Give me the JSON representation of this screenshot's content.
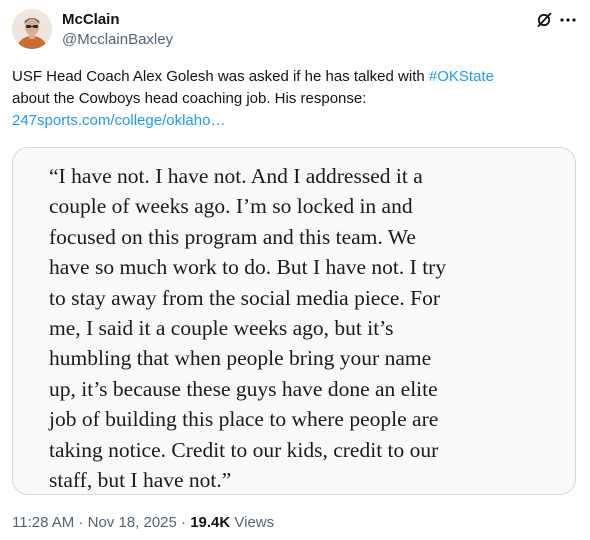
{
  "author": {
    "name": "McClain",
    "handle": "@McclainBaxley"
  },
  "tweet": {
    "text_line1_prefix": "USF Head Coach Alex Golesh was asked if he has talked with ",
    "hashtag": "#OKState",
    "text_line2": "about the Cowboys head coaching job. His response:",
    "link": "247sports.com/college/oklaho…"
  },
  "media": {
    "quote_lines": [
      "“I have not. I have not. And I addressed it a",
      "couple of weeks ago. I’m so locked in and",
      "focused on this program and this team. We",
      "have so much work to do. But I have not. I try",
      "to stay away from the social media piece. For",
      "me, I said it a couple weeks ago, but it’s",
      "humbling that when people bring your name",
      "up, it’s because these guys have done an elite",
      "job of building this place to where people are",
      "taking notice. Credit to our kids, credit to our",
      "staff, but I have not.”"
    ]
  },
  "meta": {
    "time": "11:28 AM",
    "sep1": " · ",
    "date": "Nov 18, 2025",
    "sep2": " · ",
    "views_count": "19.4K",
    "views_label": " Views"
  },
  "icons": {
    "grok": "grok-icon",
    "more": "more-icon"
  },
  "colors": {
    "link": "#1d9bf0",
    "secondary_text": "#536471",
    "primary_text": "#0f1419",
    "border": "#cfd9de"
  }
}
